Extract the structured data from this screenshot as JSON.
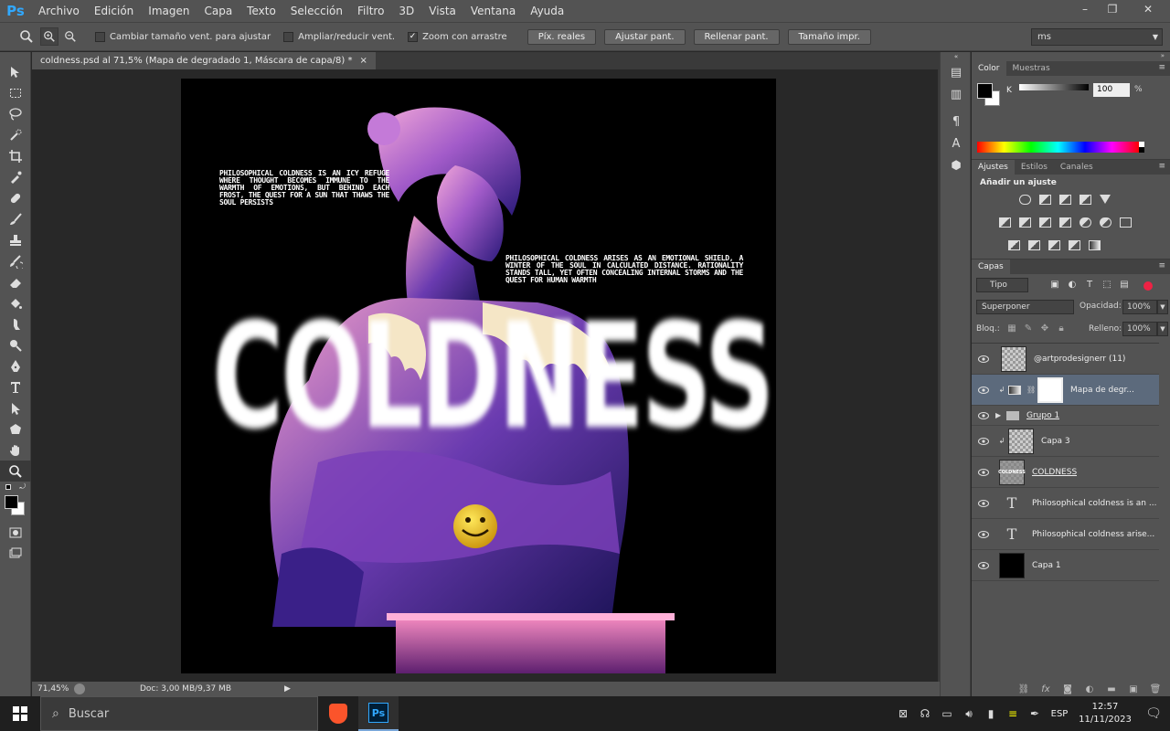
{
  "app": {
    "logo": "Ps",
    "menu": [
      "Archivo",
      "Edición",
      "Imagen",
      "Capa",
      "Texto",
      "Selección",
      "Filtro",
      "3D",
      "Vista",
      "Ventana",
      "Ayuda"
    ],
    "window_controls": [
      "–",
      "❐",
      "✕"
    ]
  },
  "options_bar": {
    "cb_resize": "Cambiar tamaño vent. para ajustar",
    "cb_zoom_all": "Ampliar/reducir vent.",
    "cb_scrubby": "Zoom con arrastre",
    "scrubby_checked_mark": "✓",
    "btn_actual": "Píx. reales",
    "btn_fit": "Ajustar pant.",
    "btn_fill": "Rellenar pant.",
    "btn_print": "Tamaño impr.",
    "workspace": "ms"
  },
  "document": {
    "tab_title": "coldness.psd al 71,5% (Mapa de degradado 1, Máscara de capa/8) *",
    "tab_close": "×",
    "zoom_level": "71,45%",
    "doc_size": "Doc: 3,00 MB/9,37 MB"
  },
  "poster": {
    "big_word": "COLDNESS",
    "text_top_left": "PHILOSOPHICAL COLDNESS IS AN ICY REFUGE WHERE THOUGHT BECOMES IMMUNE TO THE WARMTH OF EMOTIONS, BUT BEHIND EACH FROST, THE QUEST FOR A SUN THAT THAWS THE SOUL PERSISTS",
    "text_right": "PHILOSOPHICAL COLDNESS ARISES AS AN EMOTIONAL SHIELD, A WINTER OF THE SOUL IN CALCULATED DISTANCE. RATIONALITY STANDS TALL, YET OFTEN CONCEALING INTERNAL STORMS AND THE QUEST FOR HUMAN WARMTH"
  },
  "color_panel": {
    "tabs": [
      "Color",
      "Muestras"
    ],
    "channel_label": "K",
    "channel_value": "100",
    "unit": "%"
  },
  "adjustments_panel": {
    "tabs": [
      "Ajustes",
      "Estilos",
      "Canales"
    ],
    "title": "Añadir un ajuste"
  },
  "layers_panel": {
    "tab": "Capas",
    "filter": "Tipo",
    "blend_mode": "Superponer",
    "opacity_label": "Opacidad:",
    "opacity_value": "100%",
    "lock_label": "Bloq.:",
    "fill_label": "Relleno:",
    "fill_value": "100%",
    "layers": [
      {
        "name": "@artprodesignerr (11)"
      },
      {
        "name": "Mapa de degr..."
      },
      {
        "name": "Grupo 1"
      },
      {
        "name": "Capa 3"
      },
      {
        "name": "COLDNESS"
      },
      {
        "name": "Philosophical coldness is an ..."
      },
      {
        "name": "Philosophical coldness arise..."
      },
      {
        "name": "Capa 1"
      }
    ],
    "type_glyph": "T",
    "thumb_word": "COLDNESS"
  },
  "taskbar": {
    "search_placeholder": "Buscar",
    "ps_label": "Ps",
    "language": "ESP",
    "time": "12:57",
    "date": "11/11/2023"
  }
}
